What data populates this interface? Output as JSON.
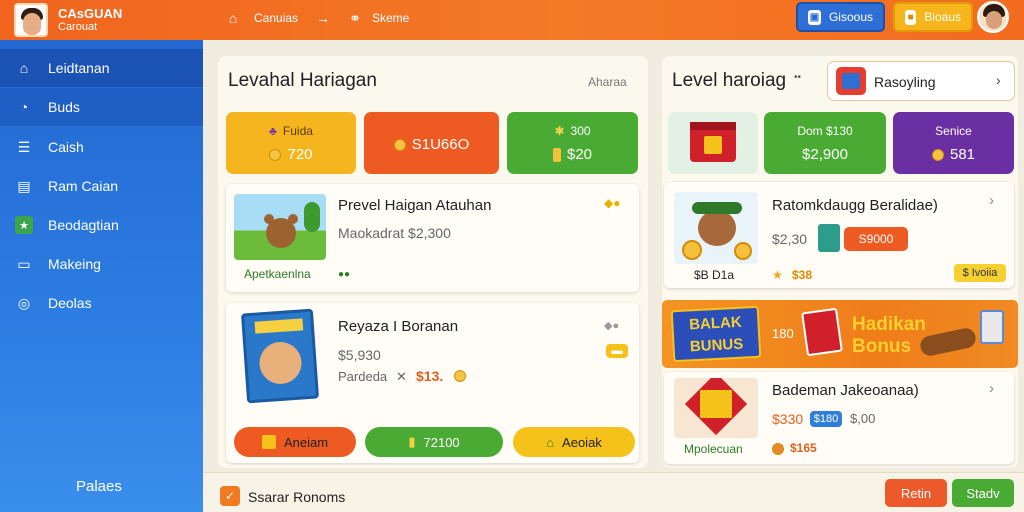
{
  "header": {
    "brand_line1": "CAsGUAN",
    "brand_line2": "Carouat",
    "crumb1": "Canuias",
    "crumb2": "Skeme",
    "btn_blue": "Gisoous",
    "btn_yellow": "Bioaus"
  },
  "sidebar": {
    "items": [
      {
        "label": "Leidtanan",
        "icon": "home-icon"
      },
      {
        "label": "Buds",
        "icon": "compass-icon"
      },
      {
        "label": "Caish",
        "icon": "list-icon"
      },
      {
        "label": "Ram Caian",
        "icon": "chart-icon"
      },
      {
        "label": "Beodagtian",
        "icon": "badge-icon"
      },
      {
        "label": "Makeing",
        "icon": "card-icon"
      },
      {
        "label": "Deolas",
        "icon": "globe-icon"
      }
    ],
    "footer": "Palaes"
  },
  "left_panel": {
    "title": "Levahal Hariagan",
    "link": "Aharaa",
    "stats": [
      {
        "label": "Fuida",
        "value": "720",
        "color": "#f5b51e"
      },
      {
        "label": "",
        "value": "S1U66O",
        "color": "#ee5b22"
      },
      {
        "label": "300",
        "value": "$20",
        "color": "#4aab34"
      }
    ],
    "card1": {
      "title": "Prevel Haigan Atauhan",
      "sub": "Maokadrat  $2,300",
      "tag": "Apetkaenlna"
    },
    "card2": {
      "title": "Reyaza I Boranan",
      "price": "$5,930",
      "line2_label": "Pardeda",
      "line2_value": "$13.",
      "btn1": "Aneiam",
      "btn2": "72100",
      "btn3": "Aeoiak"
    }
  },
  "right_panel": {
    "title": "Level haroiag",
    "dropdown": "Rasoyling",
    "stats": [
      {
        "label": "Dom $130",
        "value": "$2,900",
        "color": "#4aab34"
      },
      {
        "label": "Senice",
        "value": "581",
        "color": "#6a2fa2"
      }
    ],
    "card1": {
      "title": "Ratomkdaugg Beralidae)",
      "price": "$2,30",
      "badge": "S9000",
      "price2": "$B  D1a",
      "price3": "$38",
      "tag": "$ Ivoiia"
    },
    "banner": {
      "left_text": "BALAK BUNUS",
      "num": "180",
      "line1": "Hadikan",
      "line2": "Bonus"
    },
    "card2": {
      "title": "Bademan  Jakeoanaa)",
      "price": "$330",
      "badge": "$180",
      "price2": "$,00",
      "tag": "Mpolecuan",
      "price3": "$165"
    }
  },
  "bottom": {
    "label": "Ssarar Ronoms",
    "btn1": "Retin",
    "btn2": "Stadv",
    "btn1_color": "#ec5a2c",
    "btn2_color": "#4aab34"
  }
}
